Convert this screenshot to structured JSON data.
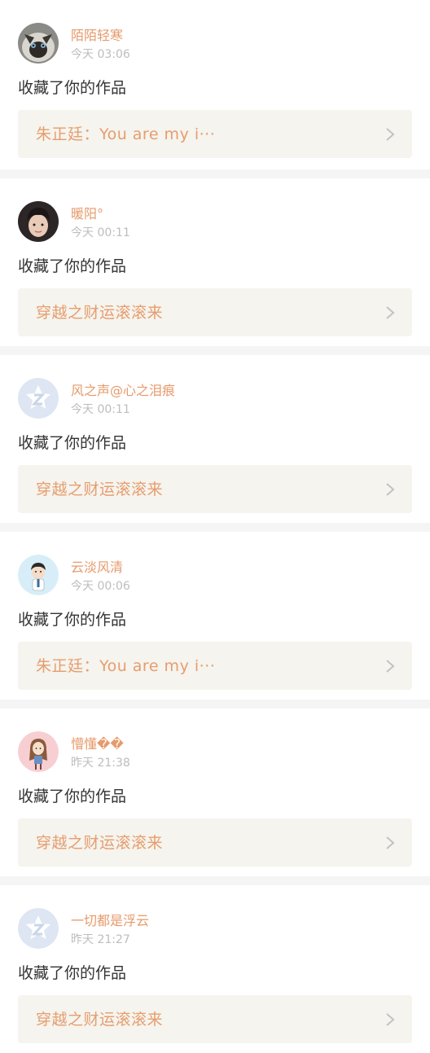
{
  "colors": {
    "accent": "#e69a6b",
    "timestamp": "#bdbdbd",
    "text": "#333333",
    "link_bg": "#f5f4ee",
    "divider": "#f6f5f5"
  },
  "feed": [
    {
      "user_name": "陌陌轻寒",
      "timestamp": "今天 03:06",
      "action": "收藏了你的作品",
      "work_title": "朱正廷：You are my i···",
      "avatar": "cat-avatar-icon"
    },
    {
      "user_name": "暖阳°",
      "timestamp": "今天 00:11",
      "action": "收藏了你的作品",
      "work_title": "穿越之财运滚滚来",
      "avatar": "photo-avatar-icon"
    },
    {
      "user_name": "风之声@心之泪痕",
      "timestamp": "今天 00:11",
      "action": "收藏了你的作品",
      "work_title": "穿越之财运滚滚来",
      "avatar": "default-avatar-icon"
    },
    {
      "user_name": "云淡风清",
      "timestamp": "今天 00:06",
      "action": "收藏了你的作品",
      "work_title": "朱正廷：You are my i···",
      "avatar": "cartoon-boy-avatar-icon"
    },
    {
      "user_name": "懵懂��",
      "timestamp": "昨天 21:38",
      "action": "收藏了你的作品",
      "work_title": "穿越之财运滚滚来",
      "avatar": "cartoon-girl-avatar-icon"
    },
    {
      "user_name": "一切都是浮云",
      "timestamp": "昨天 21:27",
      "action": "收藏了你的作品",
      "work_title": "穿越之财运滚滚来",
      "avatar": "default-avatar-icon"
    }
  ]
}
